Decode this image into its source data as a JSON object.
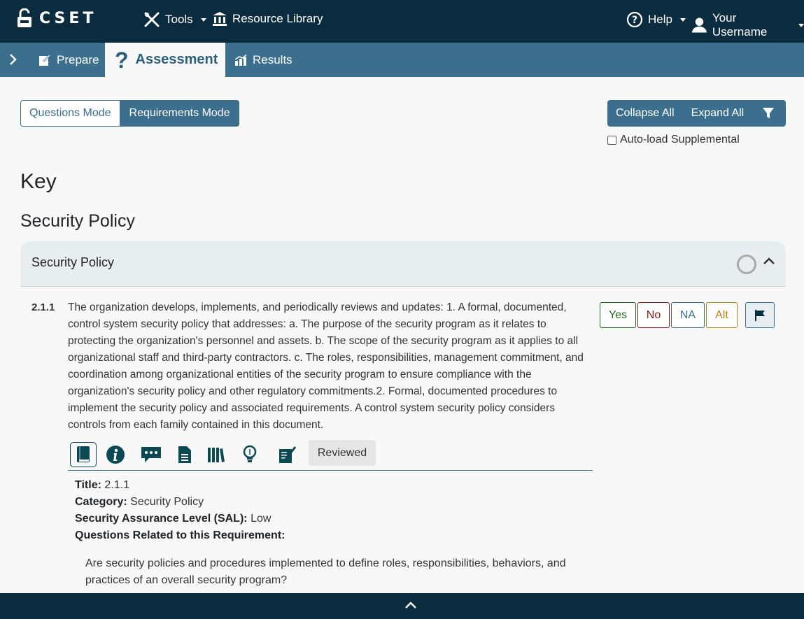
{
  "topnav": {
    "logo": "CSET",
    "tools_label": "Tools",
    "resource_library_label": "Resource Library",
    "help_label": "Help",
    "username": "Your Username"
  },
  "subnav": {
    "prepare_label": "Prepare",
    "assessment_label": "Assessment",
    "results_label": "Results"
  },
  "modes": {
    "questions_mode": "Questions Mode",
    "requirements_mode": "Requirements Mode",
    "active": "Requirements Mode"
  },
  "actions": {
    "collapse_all": "Collapse All",
    "expand_all": "Expand All",
    "autoload_label": "Auto-load Supplemental",
    "autoload_checked": false
  },
  "headings": {
    "key": "Key",
    "section": "Security Policy"
  },
  "category": {
    "title": "Security Policy"
  },
  "requirement": {
    "number": "2.1.1",
    "text": "The organization develops, implements, and periodically reviews and updates: 1. A formal, documented, control system security policy that addresses: a. The purpose of the security program as it relates to protecting the organization's personnel and assets. b. The scope of the security program as it applies to all organizational staff and third-party contractors. c. The roles, responsibilities, management commitment, and coordination among organizational entities of the security program to ensure compliance with the organization's security policy and other regulatory commitments.2. Formal, documented procedures to implement the security policy and associated requirements. A control system security policy considers controls from each family contained in this document.",
    "answers": {
      "yes": "Yes",
      "no": "No",
      "na": "NA",
      "alt": "Alt"
    },
    "reviewed_label": "Reviewed",
    "details": {
      "title_label": "Title:",
      "title_value": "2.1.1",
      "category_label": "Category:",
      "category_value": "Security Policy",
      "sal_label": "Security Assurance Level (SAL):",
      "sal_value": "Low",
      "related_label": "Questions Related to this Requirement:"
    },
    "related_question": "Are security policies and procedures implemented to define roles, responsibilities, behaviors, and practices of an overall security program?"
  },
  "colors": {
    "nav_dark": "#0b2b3e",
    "nav_mid": "#3c6f8d",
    "yes": "#1e6b1e",
    "no": "#8b1a1a",
    "na": "#3c6f8d",
    "alt": "#b8860b",
    "tool_icons": "#0b4a55"
  }
}
